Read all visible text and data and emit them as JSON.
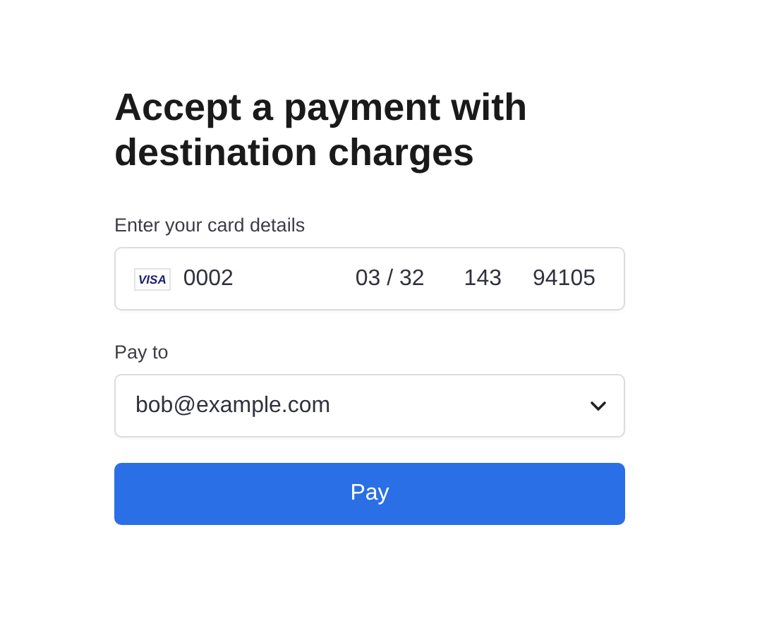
{
  "title": "Accept a payment with destination charges",
  "card": {
    "label": "Enter your card details",
    "brand": "VISA",
    "number": "0002",
    "expiry": "03 / 32",
    "cvc": "143",
    "postal": "94105"
  },
  "pay_to": {
    "label": "Pay to",
    "value": "bob@example.com"
  },
  "button": "Pay"
}
